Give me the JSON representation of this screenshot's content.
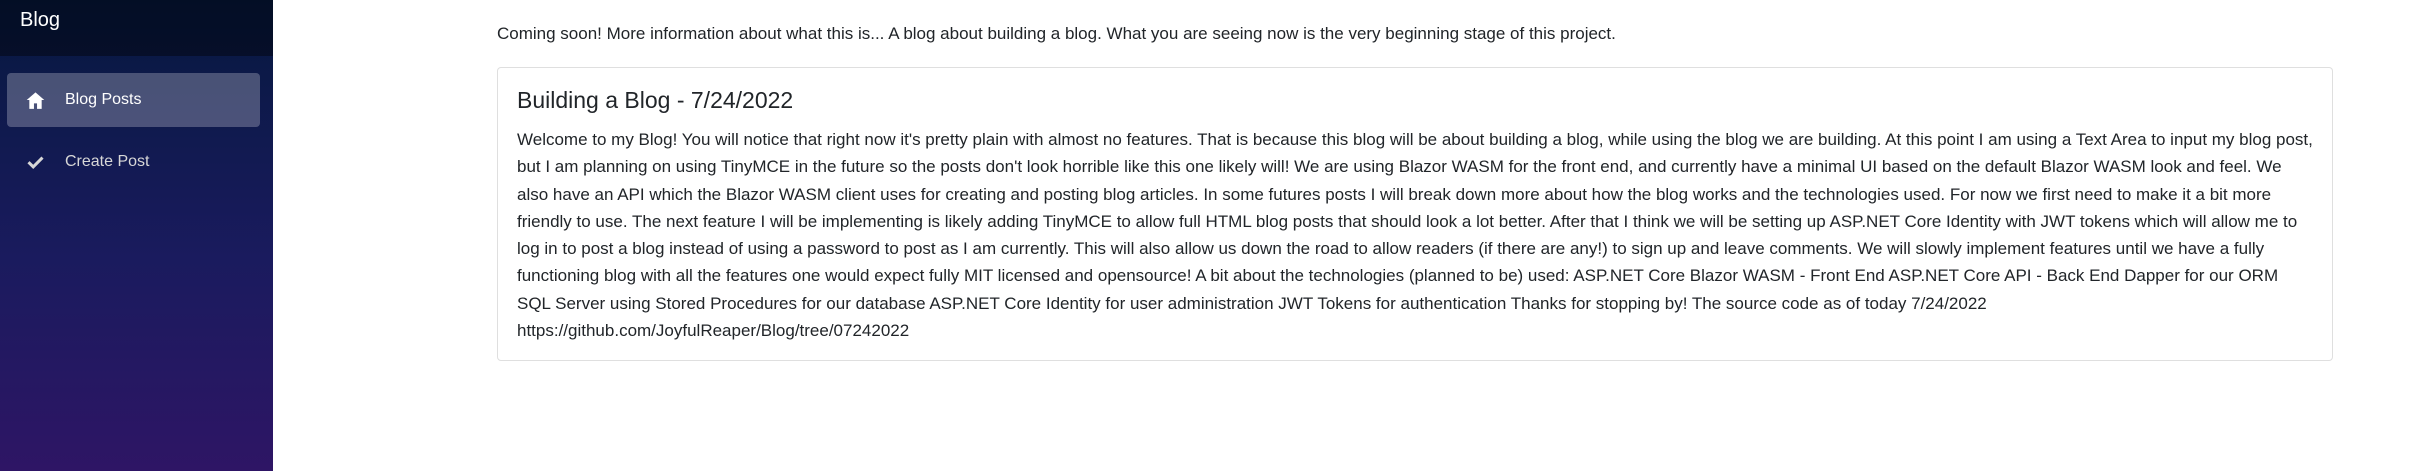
{
  "sidebar": {
    "brand": "Blog",
    "items": [
      {
        "label": "Blog Posts",
        "icon": "home-icon",
        "active": true
      },
      {
        "label": "Create Post",
        "icon": "check-icon",
        "active": false
      }
    ]
  },
  "main": {
    "intro": "Coming soon! More information about what this is... A blog about building a blog. What you are seeing now is the very beginning stage of this project.",
    "post": {
      "title": "Building a Blog - 7/24/2022",
      "body": "Welcome to my Blog! You will notice that right now it's pretty plain with almost no features. That is because this blog will be about building a blog, while using the blog we are building. At this point I am using a Text Area to input my blog post, but I am planning on using TinyMCE in the future so the posts don't look horrible like this one likely will! We are using Blazor WASM for the front end, and currently have a minimal UI based on the default Blazor WASM look and feel. We also have an API which the Blazor WASM client uses for creating and posting blog articles. In some futures posts I will break down more about how the blog works and the technologies used. For now we first need to make it a bit more friendly to use. The next feature I will be implementing is likely adding TinyMCE to allow full HTML blog posts that should look a lot better. After that I think we will be setting up ASP.NET Core Identity with JWT tokens which will allow me to log in to post a blog instead of using a password to post as I am currently. This will also allow us down the road to allow readers (if there are any!) to sign up and leave comments. We will slowly implement features until we have a fully functioning blog with all the features one would expect fully MIT licensed and opensource! A bit about the technologies (planned to be) used: ASP.NET Core Blazor WASM - Front End ASP.NET Core API - Back End Dapper for our ORM SQL Server using Stored Procedures for our database ASP.NET Core Identity for user administration JWT Tokens for authentication Thanks for stopping by! The source code as of today 7/24/2022 https://github.com/JoyfulReaper/Blog/tree/07242022"
    }
  },
  "colors": {
    "sidebar_top": "#06183f",
    "sidebar_bottom": "#2e1565",
    "text": "#212529"
  }
}
